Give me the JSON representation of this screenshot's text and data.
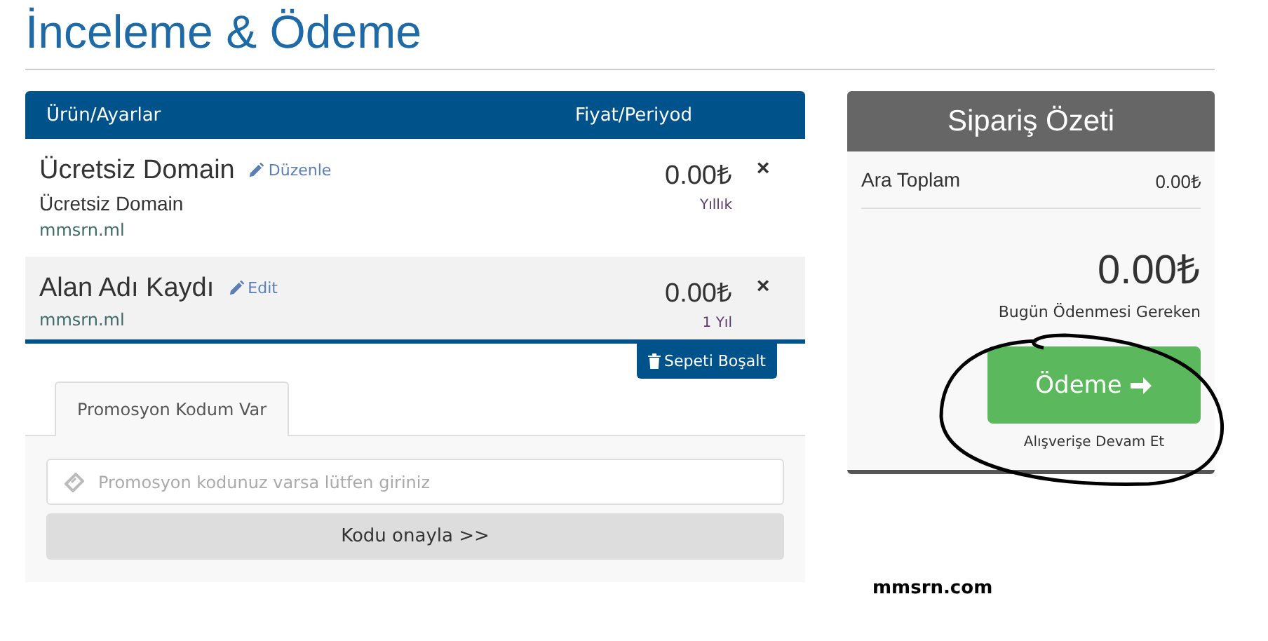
{
  "page_title": "İnceleme & Ödeme",
  "cart": {
    "columns": [
      "Ürün/Ayarlar",
      "Fiyat/Periyod"
    ],
    "items": [
      {
        "name": "Ücretsiz Domain",
        "edit_label": "Düzenle",
        "description": "Ücretsiz Domain",
        "domain": "mmsrn.ml",
        "price": "0.00₺",
        "period": "Yıllık",
        "remove": "×",
        "highlighted": false
      },
      {
        "name": "Alan Adı Kaydı",
        "edit_label": "Edit",
        "domain": "mmsrn.ml",
        "price": "0.00₺",
        "period": "1 Yıl",
        "remove": "×",
        "highlighted": true
      }
    ],
    "empty_button": "Sepeti Boşalt"
  },
  "promo": {
    "tabs": [
      {
        "label": "Promosyon Kodum Var",
        "selected": true
      }
    ],
    "placeholder": "Promosyon kodunuz varsa lütfen giriniz",
    "button": "Kodu onayla >>"
  },
  "summary": {
    "title": "Sipariş Özeti",
    "subtotal_label": "Ara Toplam",
    "subtotal": "0.00₺",
    "total": "0.00₺",
    "total_label": "Bugün Ödenmesi Gereken",
    "checkout_button": "Ödeme",
    "continue_link": "Alışverişe Devam Et"
  },
  "footer_text": "mmsrn.com"
}
